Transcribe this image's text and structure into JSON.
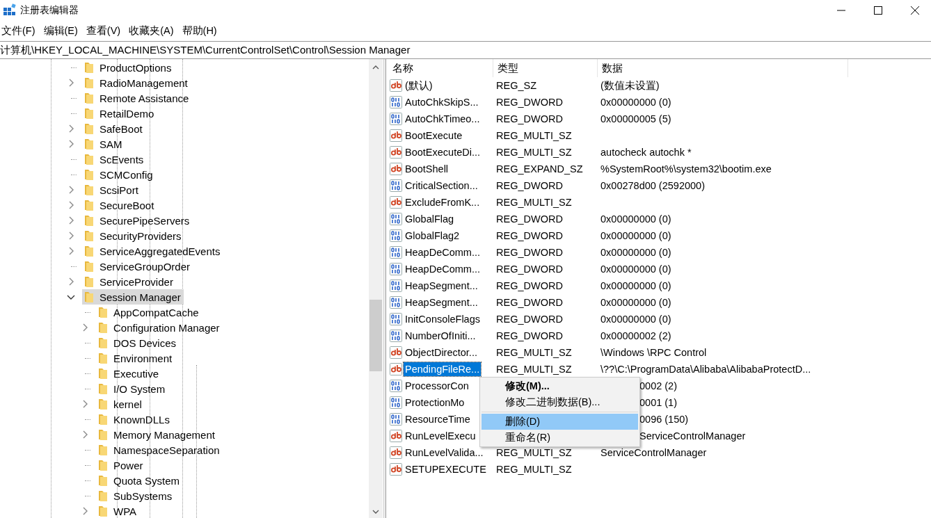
{
  "window": {
    "title": "注册表编辑器"
  },
  "menu_bar": [
    "文件(F)",
    "编辑(E)",
    "查看(V)",
    "收藏夹(A)",
    "帮助(H)"
  ],
  "address": "计算机\\HKEY_LOCAL_MACHINE\\SYSTEM\\CurrentControlSet\\Control\\Session Manager",
  "tree": [
    {
      "label": "ProductOptions",
      "expandable": false,
      "expanded": false,
      "selected": false
    },
    {
      "label": "RadioManagement",
      "expandable": true,
      "expanded": false,
      "selected": false
    },
    {
      "label": "Remote Assistance",
      "expandable": false,
      "expanded": false,
      "selected": false
    },
    {
      "label": "RetailDemo",
      "expandable": false,
      "expanded": false,
      "selected": false
    },
    {
      "label": "SafeBoot",
      "expandable": true,
      "expanded": false,
      "selected": false
    },
    {
      "label": "SAM",
      "expandable": true,
      "expanded": false,
      "selected": false
    },
    {
      "label": "ScEvents",
      "expandable": false,
      "expanded": false,
      "selected": false
    },
    {
      "label": "SCMConfig",
      "expandable": false,
      "expanded": false,
      "selected": false
    },
    {
      "label": "ScsiPort",
      "expandable": true,
      "expanded": false,
      "selected": false
    },
    {
      "label": "SecureBoot",
      "expandable": true,
      "expanded": false,
      "selected": false
    },
    {
      "label": "SecurePipeServers",
      "expandable": true,
      "expanded": false,
      "selected": false
    },
    {
      "label": "SecurityProviders",
      "expandable": true,
      "expanded": false,
      "selected": false
    },
    {
      "label": "ServiceAggregatedEvents",
      "expandable": true,
      "expanded": false,
      "selected": false
    },
    {
      "label": "ServiceGroupOrder",
      "expandable": false,
      "expanded": false,
      "selected": false
    },
    {
      "label": "ServiceProvider",
      "expandable": true,
      "expanded": false,
      "selected": false
    },
    {
      "label": "Session Manager",
      "expandable": true,
      "expanded": true,
      "selected": true,
      "children": [
        {
          "label": "AppCompatCache",
          "expandable": false,
          "expanded": false,
          "selected": false
        },
        {
          "label": "Configuration Manager",
          "expandable": true,
          "expanded": false,
          "selected": false
        },
        {
          "label": "DOS Devices",
          "expandable": false,
          "expanded": false,
          "selected": false
        },
        {
          "label": "Environment",
          "expandable": false,
          "expanded": false,
          "selected": false
        },
        {
          "label": "Executive",
          "expandable": false,
          "expanded": false,
          "selected": false
        },
        {
          "label": "I/O System",
          "expandable": false,
          "expanded": false,
          "selected": false
        },
        {
          "label": "kernel",
          "expandable": true,
          "expanded": false,
          "selected": false
        },
        {
          "label": "KnownDLLs",
          "expandable": false,
          "expanded": false,
          "selected": false
        },
        {
          "label": "Memory Management",
          "expandable": true,
          "expanded": false,
          "selected": false
        },
        {
          "label": "NamespaceSeparation",
          "expandable": false,
          "expanded": false,
          "selected": false
        },
        {
          "label": "Power",
          "expandable": false,
          "expanded": false,
          "selected": false
        },
        {
          "label": "Quota System",
          "expandable": false,
          "expanded": false,
          "selected": false
        },
        {
          "label": "SubSystems",
          "expandable": false,
          "expanded": false,
          "selected": false
        },
        {
          "label": "WPA",
          "expandable": true,
          "expanded": false,
          "selected": false
        }
      ]
    }
  ],
  "table": {
    "columns": [
      "名称",
      "类型",
      "数据"
    ],
    "rows": [
      {
        "kind": "string",
        "name": "(默认)",
        "type": "REG_SZ",
        "data": "(数值未设置)",
        "selected": false
      },
      {
        "kind": "binary",
        "name": "AutoChkSkipS...",
        "type": "REG_DWORD",
        "data": "0x00000000 (0)",
        "selected": false
      },
      {
        "kind": "binary",
        "name": "AutoChkTimeo...",
        "type": "REG_DWORD",
        "data": "0x00000005 (5)",
        "selected": false
      },
      {
        "kind": "string",
        "name": "BootExecute",
        "type": "REG_MULTI_SZ",
        "selected": false
      },
      {
        "kind": "string",
        "name": "BootExecuteDi...",
        "type": "REG_MULTI_SZ",
        "data": "autocheck autochk *",
        "selected": false
      },
      {
        "kind": "string",
        "name": "BootShell",
        "type": "REG_EXPAND_SZ",
        "data": "%SystemRoot%\\system32\\bootim.exe",
        "selected": false
      },
      {
        "kind": "binary",
        "name": "CriticalSection...",
        "type": "REG_DWORD",
        "data": "0x00278d00 (2592000)",
        "selected": false
      },
      {
        "kind": "string",
        "name": "ExcludeFromK...",
        "type": "REG_MULTI_SZ",
        "selected": false
      },
      {
        "kind": "binary",
        "name": "GlobalFlag",
        "type": "REG_DWORD",
        "data": "0x00000000 (0)",
        "selected": false
      },
      {
        "kind": "binary",
        "name": "GlobalFlag2",
        "type": "REG_DWORD",
        "data": "0x00000000 (0)",
        "selected": false
      },
      {
        "kind": "binary",
        "name": "HeapDeComm...",
        "type": "REG_DWORD",
        "data": "0x00000000 (0)",
        "selected": false
      },
      {
        "kind": "binary",
        "name": "HeapDeComm...",
        "type": "REG_DWORD",
        "data": "0x00000000 (0)",
        "selected": false
      },
      {
        "kind": "binary",
        "name": "HeapSegment...",
        "type": "REG_DWORD",
        "data": "0x00000000 (0)",
        "selected": false
      },
      {
        "kind": "binary",
        "name": "HeapSegment...",
        "type": "REG_DWORD",
        "data": "0x00000000 (0)",
        "selected": false
      },
      {
        "kind": "binary",
        "name": "InitConsoleFlags",
        "type": "REG_DWORD",
        "data": "0x00000000 (0)",
        "selected": false
      },
      {
        "kind": "binary",
        "name": "NumberOfIniti...",
        "type": "REG_DWORD",
        "data": "0x00000002 (2)",
        "selected": false
      },
      {
        "kind": "string",
        "name": "ObjectDirector...",
        "type": "REG_MULTI_SZ",
        "data": "\\Windows \\RPC Control",
        "selected": false
      },
      {
        "kind": "string",
        "name": "PendingFileRe...",
        "type": "REG_MULTI_SZ",
        "data": "\\??\\C:\\ProgramData\\Alibaba\\AlibabaProtectD...",
        "selected": true
      },
      {
        "kind": "binary",
        "name": "ProcessorCon",
        "data": "0002 (2)",
        "selected": false
      },
      {
        "kind": "binary",
        "name": "ProtectionMo",
        "data": "0001 (1)",
        "selected": false
      },
      {
        "kind": "binary",
        "name": "ResourceTime",
        "data": "0096 (150)",
        "selected": false
      },
      {
        "kind": "string",
        "name": "RunLevelExecu",
        "data": "ServiceControlManager",
        "selected": false
      },
      {
        "kind": "string",
        "name": "RunLevelValida...",
        "type": "REG_MULTI_SZ",
        "data": "ServiceControlManager",
        "selected": false
      },
      {
        "kind": "string",
        "name": "SETUPEXECUTE",
        "type": "REG_MULTI_SZ",
        "selected": false
      }
    ]
  },
  "context_menu": [
    {
      "kind": "default",
      "label": "修改(M)...",
      "selected": false
    },
    {
      "kind": "item",
      "label": "修改二进制数据(B)...",
      "selected": false
    },
    {
      "kind": "separator"
    },
    {
      "kind": "item",
      "label": "删除(D)",
      "selected": true
    },
    {
      "kind": "item",
      "label": "重命名(R)",
      "selected": false
    }
  ]
}
